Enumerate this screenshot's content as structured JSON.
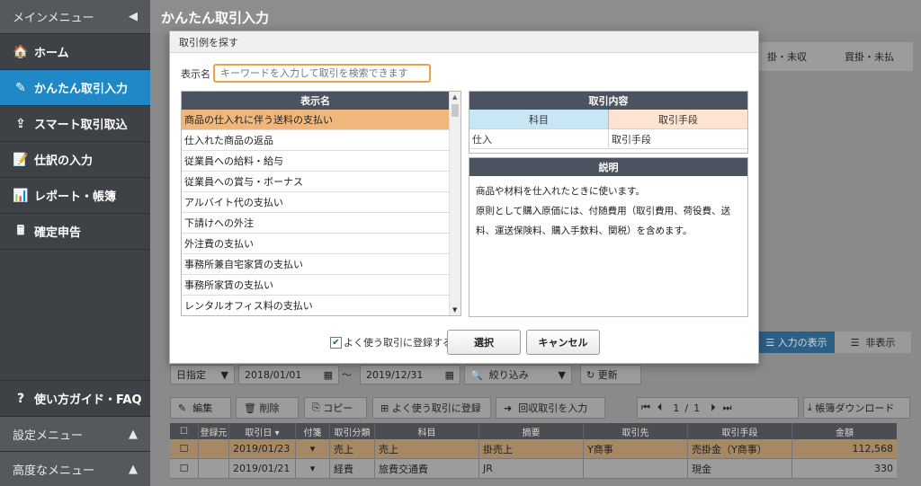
{
  "sidebar": {
    "header": "メインメニュー",
    "items": [
      {
        "label": "ホーム",
        "icon": "home-icon",
        "glyph": "🏠"
      },
      {
        "label": "かんたん取引入力",
        "icon": "pencil-icon",
        "glyph": "✎"
      },
      {
        "label": "スマート取引取込",
        "icon": "import-icon",
        "glyph": "⇪"
      },
      {
        "label": "仕訳の入力",
        "icon": "journal-icon",
        "glyph": "📝"
      },
      {
        "label": "レポート・帳簿",
        "icon": "chart-icon",
        "glyph": "📊"
      },
      {
        "label": "確定申告",
        "icon": "tax-return-icon",
        "glyph": "🖩"
      }
    ],
    "guide": "使い方ガイド・FAQ",
    "settings": "設定メニュー",
    "advanced": "高度なメニュー"
  },
  "page": {
    "title": "かんたん取引入力"
  },
  "background": {
    "columns": [
      "掛・未収",
      "買掛・未払"
    ],
    "toggle_show": "入力の表示",
    "toggle_hide": "非表示",
    "date_mode": "日指定",
    "date_from": "2018/01/01",
    "date_sep": "〜",
    "date_to": "2019/12/31",
    "filter_label": "絞り込み",
    "update_label": "更新",
    "buttons": {
      "edit": "編集",
      "delete": "削除",
      "copy": "コピー",
      "favorite": "よく使う取引に登録",
      "recover": "回収取引を入力",
      "download": "帳簿ダウンロード"
    },
    "pager": {
      "current": "1",
      "sep": "/",
      "total": "1"
    },
    "table": {
      "headers": [
        "登録元",
        "取引日 ▾",
        "付箋",
        "取引分類",
        "科目",
        "摘要",
        "取引先",
        "取引手段",
        "金額"
      ],
      "rows": [
        {
          "date": "2019/01/23",
          "category": "売上",
          "account": "売上",
          "summary": "掛売上",
          "partner": "Y商事",
          "method": "売掛金（Y商事）",
          "amount": "112,568"
        },
        {
          "date": "2019/01/21",
          "category": "経費",
          "account": "旅費交通費",
          "summary": "JR",
          "partner": "",
          "method": "現金",
          "amount": "330"
        }
      ]
    }
  },
  "modal": {
    "title": "取引例を探す",
    "search_label": "表示名",
    "search_placeholder": "キーワードを入力して取引を検索できます",
    "list_header": "表示名",
    "list": [
      "商品の仕入れに伴う送料の支払い",
      "仕入れた商品の返品",
      "従業員への給料・給与",
      "従業員への賞与・ボーナス",
      "アルバイト代の支払い",
      "下請けへの外注",
      "外注費の支払い",
      "事務所兼自宅家賃の支払い",
      "事務所家賃の支払い",
      "レンタルオフィス料の支払い"
    ],
    "content_header": "取引内容",
    "content_col1": "科目",
    "content_col2": "取引手段",
    "content_val1": "仕入",
    "content_val2": "取引手段",
    "desc_header": "説明",
    "desc_line1": "商品や材料を仕入れたときに使います。",
    "desc_line2": "原則として購入原価には、付随費用（取引費用、荷役費、送料、運送保険料、購入手数料、関税）を含めます。",
    "register_label": "よく使う取引に登録する",
    "select_label": "選択",
    "cancel_label": "キャンセル"
  }
}
